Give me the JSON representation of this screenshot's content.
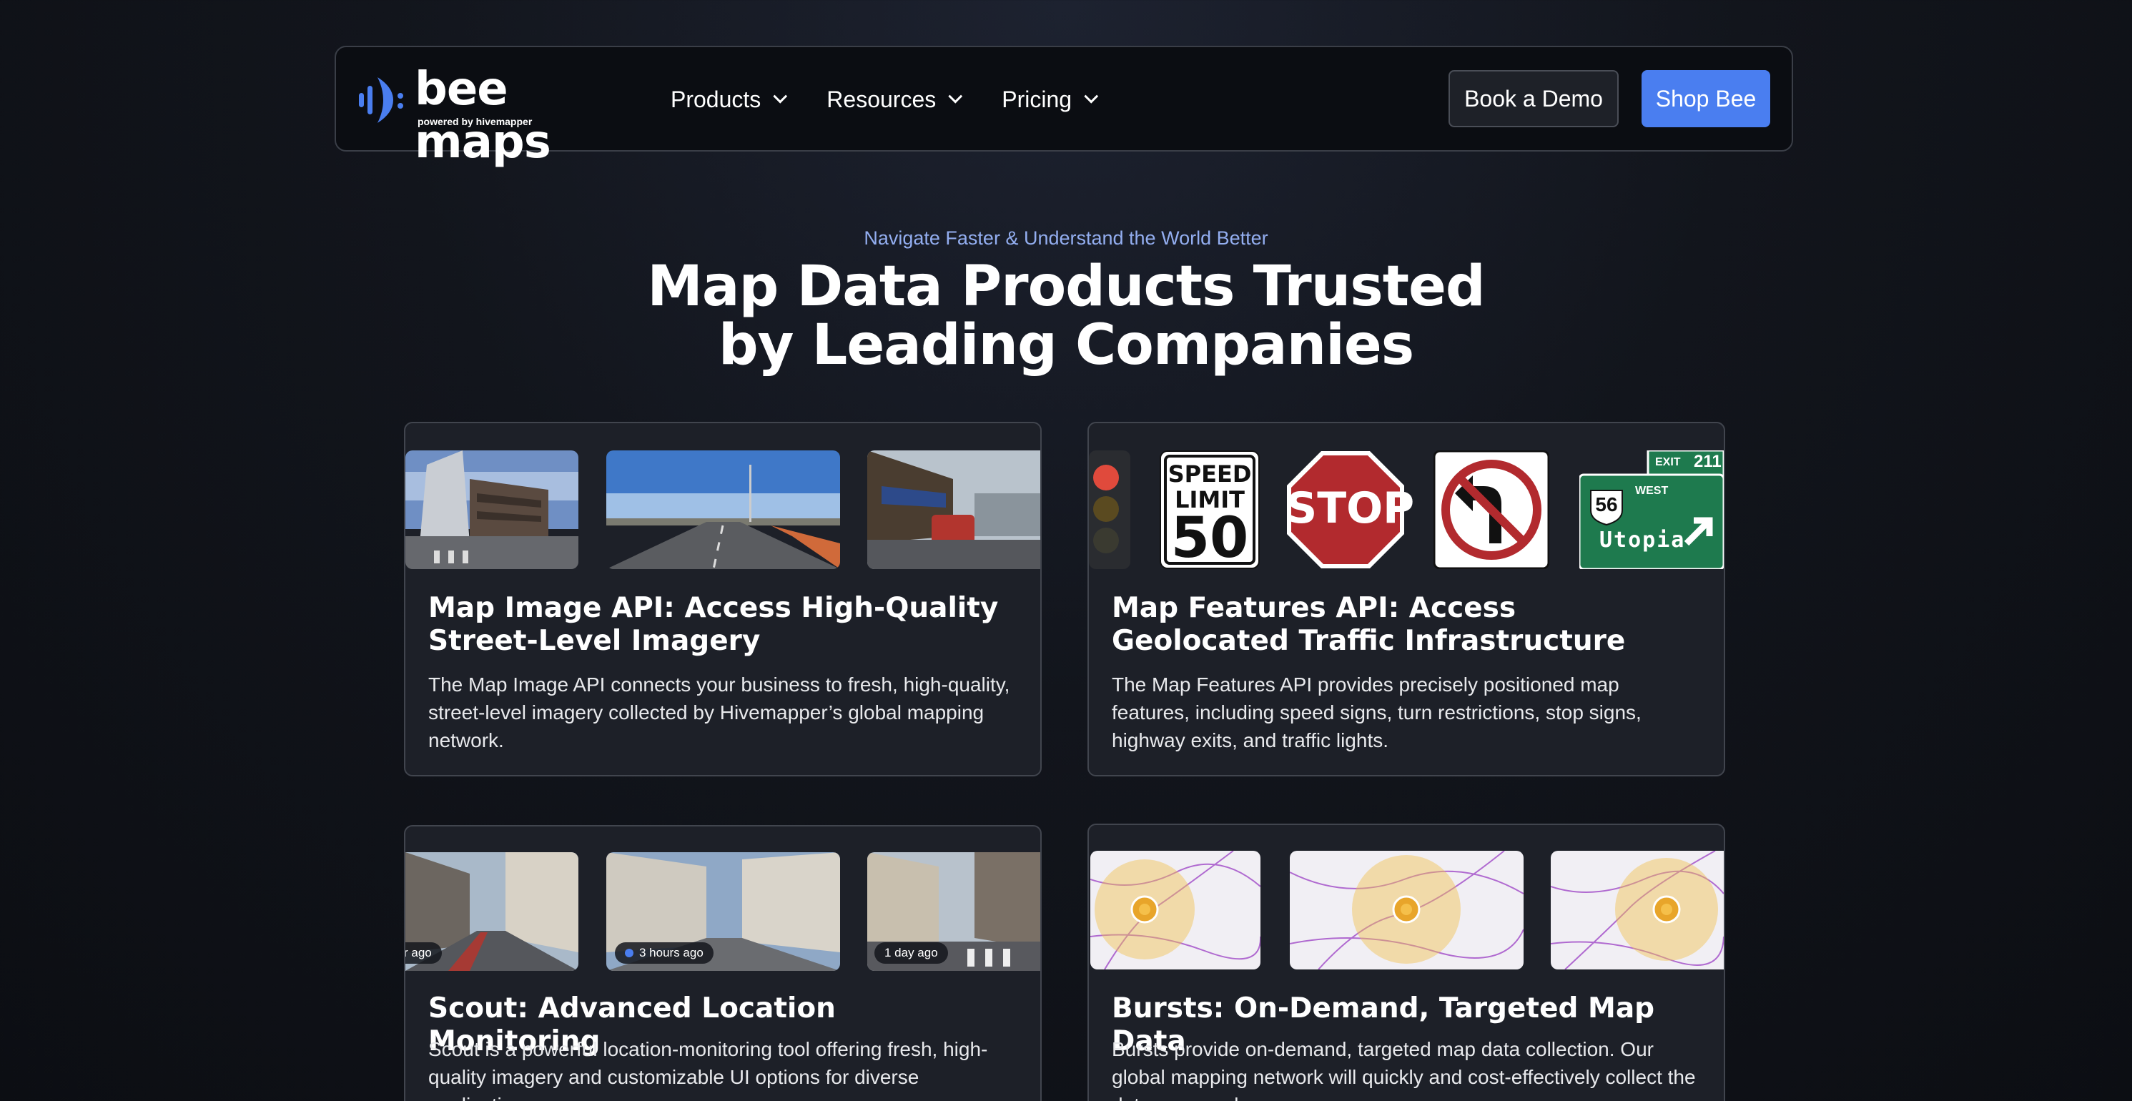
{
  "nav": {
    "logo_text": "bee maps",
    "logo_sub": "powered by hivemapper",
    "items": [
      {
        "label": "Products"
      },
      {
        "label": "Resources"
      },
      {
        "label": "Pricing"
      }
    ],
    "demo_label": "Book a Demo",
    "shop_label": "Shop Bee"
  },
  "hero": {
    "eyebrow": "Navigate Faster & Understand the World Better",
    "title": "Map Data Products Trusted by Leading Companies"
  },
  "cards": [
    {
      "title": "Map Image API: Access High-Quality Street-Level Imagery",
      "desc": "The Map Image API connects your business to fresh, high-quality, street-level imagery collected by Hivemapper’s global mapping network."
    },
    {
      "title": "Map Features API: Access Geolocated Traffic Infrastructure",
      "desc": "The Map Features API provides precisely positioned map features, including speed signs, turn restrictions, stop signs, highway exits, and traffic lights.",
      "signs": {
        "speed_top": "SPEED",
        "speed_mid": "LIMIT",
        "speed_num": "50",
        "stop": "STOP",
        "exit_label": "EXIT",
        "exit_num": "211",
        "route": "56",
        "direction": "WEST",
        "destination": "Utopia"
      }
    },
    {
      "title": "Scout: Advanced Location Monitoring",
      "desc": "Scout is a powerful location-monitoring tool offering fresh, high-quality imagery and customizable UI options for diverse applications.",
      "badges": [
        "r ago",
        "3 hours ago",
        "1 day ago"
      ]
    },
    {
      "title": "Bursts: On-Demand, Targeted Map Data",
      "desc": "Bursts provide on-demand, targeted map data collection. Our global mapping network will quickly and cost-effectively collect the data you need."
    }
  ],
  "colors": {
    "accent": "#4a7ef0",
    "eyebrow": "#93aef0",
    "card_bg": "#1d2028"
  }
}
